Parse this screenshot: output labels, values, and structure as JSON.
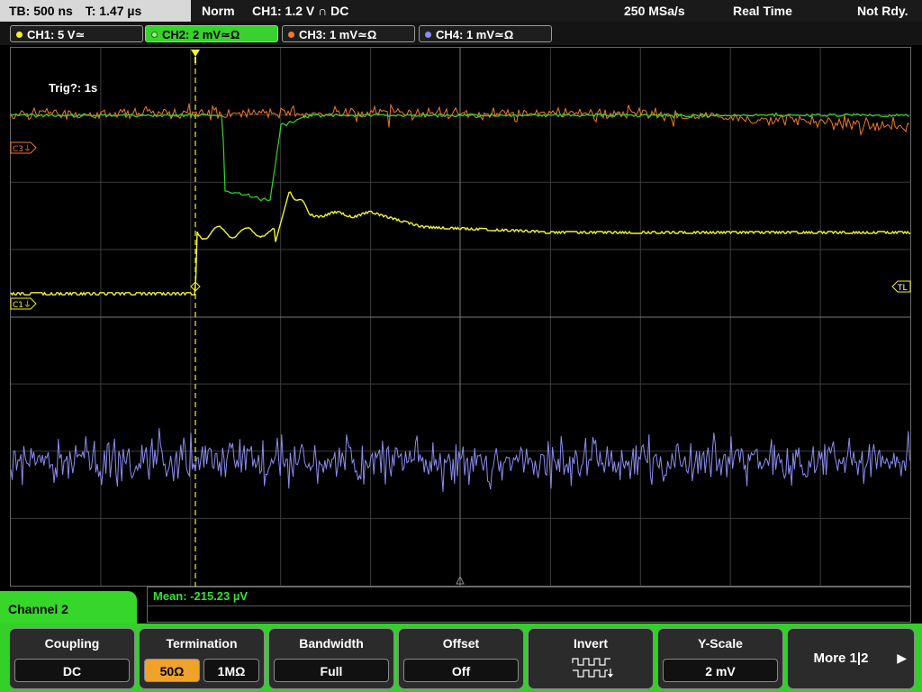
{
  "top_bar": {
    "timebase": "TB: 500 ns",
    "trigger_time": "T: 1.47 µs",
    "mode": "Norm",
    "trigger": "CH1: 1.2 V ∩ DC",
    "sample_rate": "250 MSa/s",
    "acq_mode": "Real Time",
    "status": "Not Rdy."
  },
  "channels": [
    {
      "label": "CH1: 5 V≃",
      "color": "#f4f42a"
    },
    {
      "label": "CH2: 2 mV≃Ω",
      "color": "#37d62b"
    },
    {
      "label": "CH3: 1 mV≃Ω",
      "color": "#f07a2a"
    },
    {
      "label": "CH4: 1 mV≃Ω",
      "color": "#8c8cf0"
    }
  ],
  "screen": {
    "trigger_timeout": "Trig?: 1s",
    "markers": {
      "c1": "C1⏚",
      "c3": "C3⏚",
      "tl": "TL"
    }
  },
  "measurement": {
    "mean": "Mean: -215.23 µV"
  },
  "channel_panel": {
    "title": "Channel 2"
  },
  "softkeys": {
    "coupling": {
      "title": "Coupling",
      "value": "DC"
    },
    "termination": {
      "title": "Termination",
      "option_a": "50Ω",
      "option_b": "1MΩ"
    },
    "bandwidth": {
      "title": "Bandwidth",
      "value": "Full"
    },
    "offset": {
      "title": "Offset",
      "value": "Off"
    },
    "invert": {
      "title": "Invert",
      "icon": "invert-icon"
    },
    "yscale": {
      "title": "Y-Scale",
      "value": "2 mV"
    },
    "more": {
      "label": "More 1|2"
    }
  }
}
